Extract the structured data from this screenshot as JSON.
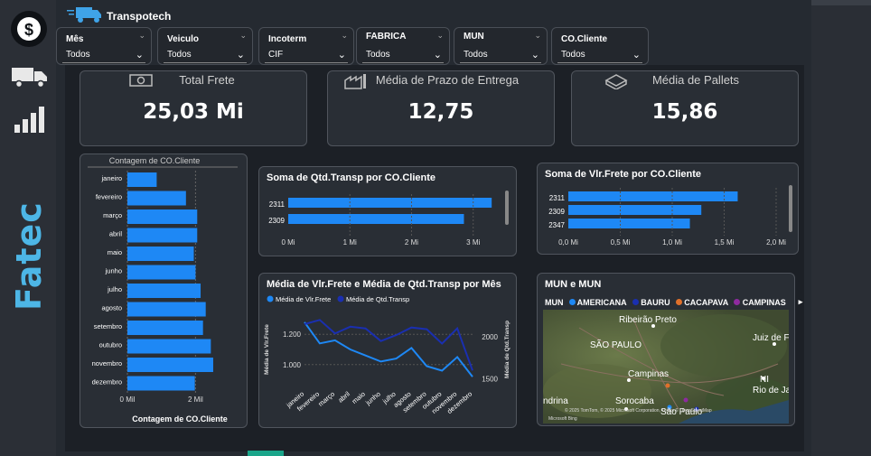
{
  "brand": {
    "name": "Transpotech",
    "side_label": "Fatec"
  },
  "sidebar_icons": [
    "dollar-icon",
    "truck-icon",
    "bar-chart-icon"
  ],
  "slicers": [
    {
      "label": "Mês",
      "value": "Todos"
    },
    {
      "label": "Veiculo",
      "value": "Todos"
    },
    {
      "label": "Incoterm",
      "value": "CIF"
    },
    {
      "label": "FABRICA",
      "value": "Todos"
    },
    {
      "label": "MUN",
      "value": "Todos"
    },
    {
      "label": "CO.Cliente",
      "value": "Todos"
    }
  ],
  "kpis": [
    {
      "title": "Total Frete",
      "value": "25,03 Mi",
      "icon": "money-icon"
    },
    {
      "title": "Média de Prazo de Entrega",
      "value": "12,75",
      "icon": "factory-icon"
    },
    {
      "title": "Média de Pallets",
      "value": "15,86",
      "icon": "pallet-icon"
    }
  ],
  "chart_data": [
    {
      "type": "bar",
      "orientation": "horizontal",
      "title": "Contagem de CO.Cliente",
      "xlabel": "Contagem de CO.Cliente",
      "categories": [
        "janeiro",
        "fevereiro",
        "março",
        "abril",
        "maio",
        "junho",
        "julho",
        "agosto",
        "setembro",
        "outubro",
        "novembro",
        "dezembro"
      ],
      "values": [
        860,
        1720,
        2050,
        2050,
        1950,
        2000,
        2150,
        2300,
        2220,
        2450,
        2520,
        1980
      ],
      "xticks": [
        "0 Mil",
        "2 Mil"
      ],
      "xlim": [
        0,
        2600
      ],
      "color": "#1e88f5"
    },
    {
      "type": "bar",
      "orientation": "horizontal",
      "title": "Soma de Qtd.Transp por CO.Cliente",
      "categories": [
        "2311",
        "2309"
      ],
      "values": [
        3.3,
        2.85
      ],
      "xticks": [
        "0 Mi",
        "1 Mi",
        "2 Mi",
        "3 Mi"
      ],
      "xlim": [
        0,
        3.4
      ],
      "color": "#1e88f5"
    },
    {
      "type": "bar",
      "orientation": "horizontal",
      "title": "Soma de Vlr.Frete por CO.Cliente",
      "categories": [
        "2311",
        "2309",
        "2347"
      ],
      "values": [
        1.63,
        1.28,
        1.17
      ],
      "xticks": [
        "0,0 Mi",
        "0,5 Mi",
        "1,0 Mi",
        "1,5 Mi",
        "2,0 Mi"
      ],
      "xlim": [
        0,
        2.0
      ],
      "color": "#1e88f5"
    },
    {
      "type": "line",
      "title": "Média de Vlr.Frete e Média de Qtd.Transp por Mês",
      "categories": [
        "janeiro",
        "fevereiro",
        "março",
        "abril",
        "maio",
        "junho",
        "julho",
        "agosto",
        "setembro",
        "outubro",
        "novembro",
        "dezembro"
      ],
      "ylabel": "Média de Vlr.Frete",
      "y2label": "Média de Qtd.Transp",
      "yticks": [
        "1.200",
        "1.000"
      ],
      "y2ticks": [
        "2000",
        "1500"
      ],
      "series": [
        {
          "name": "Média de Vlr.Frete",
          "axis": "left",
          "color": "#1e88f5",
          "values": [
            1280,
            1140,
            1160,
            1100,
            1060,
            1020,
            1040,
            1110,
            990,
            960,
            1050,
            920
          ]
        },
        {
          "name": "Média de Qtd.Transp",
          "axis": "right",
          "color": "#1a2fb0",
          "values": [
            2150,
            2200,
            2040,
            2120,
            2100,
            1950,
            2020,
            2110,
            2090,
            1920,
            2100,
            1600
          ]
        }
      ],
      "ylim": [
        850,
        1350
      ],
      "y2lim": [
        1400,
        2300
      ]
    }
  ],
  "map": {
    "title": "MUN e MUN",
    "legend_title": "MUN",
    "legend": [
      {
        "name": "AMERICANA",
        "color": "#1e88f5"
      },
      {
        "name": "BAURU",
        "color": "#1a2fb0"
      },
      {
        "name": "CACAPAVA",
        "color": "#e0702a"
      },
      {
        "name": "CAMPINAS",
        "color": "#8e2aa0"
      }
    ],
    "places": [
      "Ribeirão Preto",
      "SÃO PAULO",
      "Juiz de F",
      "Campinas",
      "Sorocaba",
      "São Paulo",
      "Rio de Ja",
      "ndrina",
      "NI"
    ],
    "attribution": "© 2025 TomTom, © 2025 Microsoft Corporation, Terms © OpenStreetMap",
    "logo": "Microsoft Bing"
  }
}
